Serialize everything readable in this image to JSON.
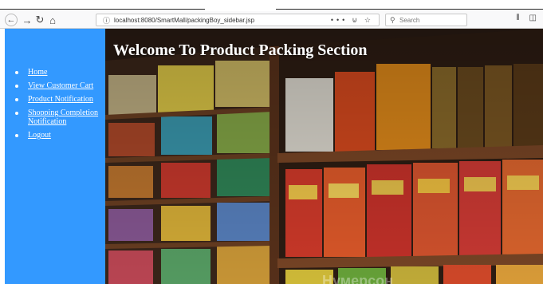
{
  "browser": {
    "url": "localhost:8080/SmartMall/packingBoy_sidebar.jsp",
    "search_placeholder": "Search",
    "nav": {
      "back_icon": "arrow-left",
      "forward_icon": "arrow-right",
      "reload_icon": "reload",
      "home_icon": "home"
    },
    "url_actions": [
      "more-icon",
      "pocket-icon",
      "bookmark-star-icon"
    ],
    "right_icons": [
      "library-icon",
      "sidebar-icon"
    ]
  },
  "sidebar": {
    "background": "#3399ff",
    "items": [
      {
        "label": "Home"
      },
      {
        "label": "View Customer Cart"
      },
      {
        "label": "Product Notification"
      },
      {
        "label": "Shopping Completion Notification"
      },
      {
        "label": "Logout"
      }
    ]
  },
  "hero": {
    "title": "Welcome To Product Packing Section",
    "watermark": "Нумерсон"
  }
}
